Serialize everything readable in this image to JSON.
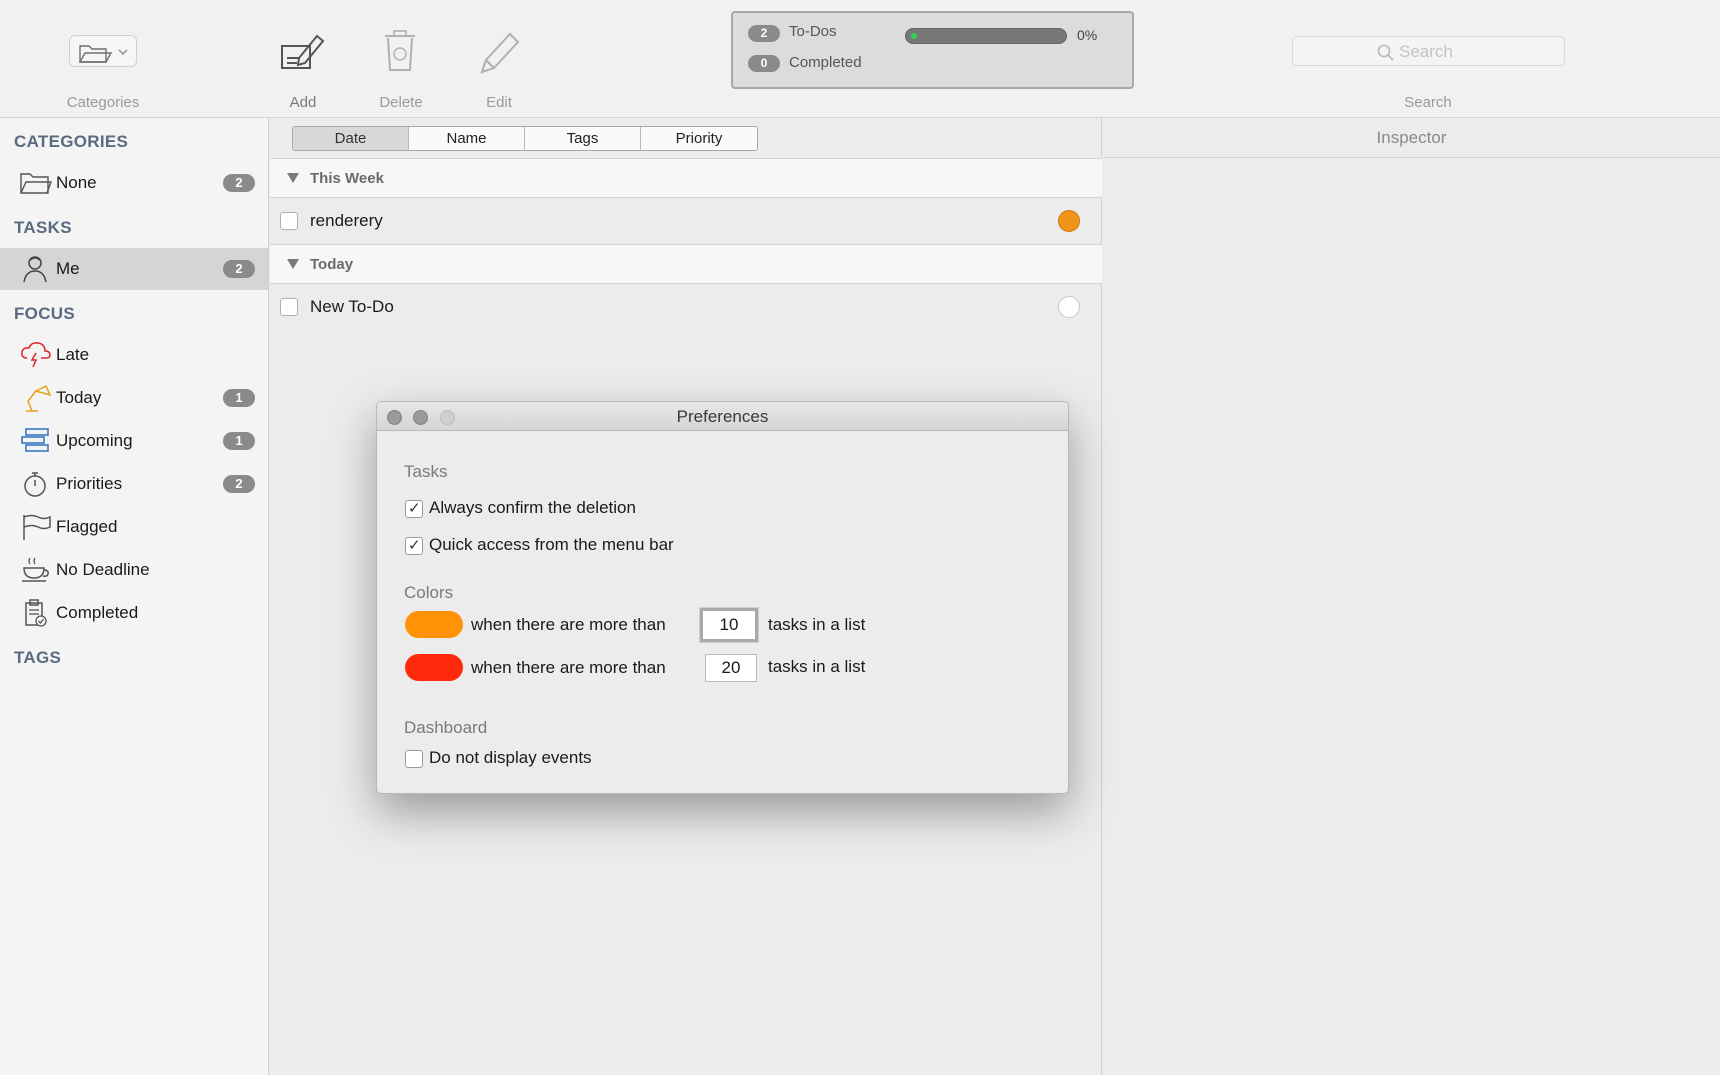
{
  "toolbar": {
    "categories_label": "Categories",
    "add_label": "Add",
    "delete_label": "Delete",
    "edit_label": "Edit",
    "search_label": "Search",
    "search_placeholder": "Search"
  },
  "status": {
    "todos_count": "2",
    "todos_label": "To-Dos",
    "completed_count": "0",
    "completed_label": "Completed",
    "progress_percent": "0%",
    "progress_value": 0
  },
  "sidebar": {
    "categories_header": "CATEGORIES",
    "tasks_header": "TASKS",
    "focus_header": "FOCUS",
    "tags_header": "TAGS",
    "categories": [
      {
        "label": "None",
        "badge": "2"
      }
    ],
    "tasks": [
      {
        "label": "Me",
        "badge": "2"
      }
    ],
    "focus": [
      {
        "label": "Late",
        "badge": ""
      },
      {
        "label": "Today",
        "badge": "1"
      },
      {
        "label": "Upcoming",
        "badge": "1"
      },
      {
        "label": "Priorities",
        "badge": "2"
      },
      {
        "label": "Flagged",
        "badge": ""
      },
      {
        "label": "No Deadline",
        "badge": ""
      },
      {
        "label": "Completed",
        "badge": ""
      }
    ]
  },
  "list": {
    "sort_tabs": [
      "Date",
      "Name",
      "Tags",
      "Priority"
    ],
    "groups": [
      {
        "title": "This Week",
        "tasks": [
          {
            "label": "renderery",
            "priority_color": "#ef9418"
          }
        ]
      },
      {
        "title": "Today",
        "tasks": [
          {
            "label": "New To-Do",
            "priority_color": "#ffffff"
          }
        ]
      }
    ]
  },
  "inspector": {
    "title": "Inspector"
  },
  "preferences": {
    "title": "Preferences",
    "tasks_section": "Tasks",
    "confirm_deletion": "Always confirm the deletion",
    "confirm_deletion_checked": true,
    "menu_bar_access": "Quick access from the menu bar",
    "menu_bar_access_checked": true,
    "colors_section": "Colors",
    "color_rule_text": "when there are more than",
    "color_rule_suffix": "tasks in a list",
    "orange_threshold": "10",
    "red_threshold": "20",
    "orange_color": "#ff9305",
    "red_color": "#ff2a0c",
    "dashboard_section": "Dashboard",
    "no_events": "Do not display events",
    "no_events_checked": false
  }
}
